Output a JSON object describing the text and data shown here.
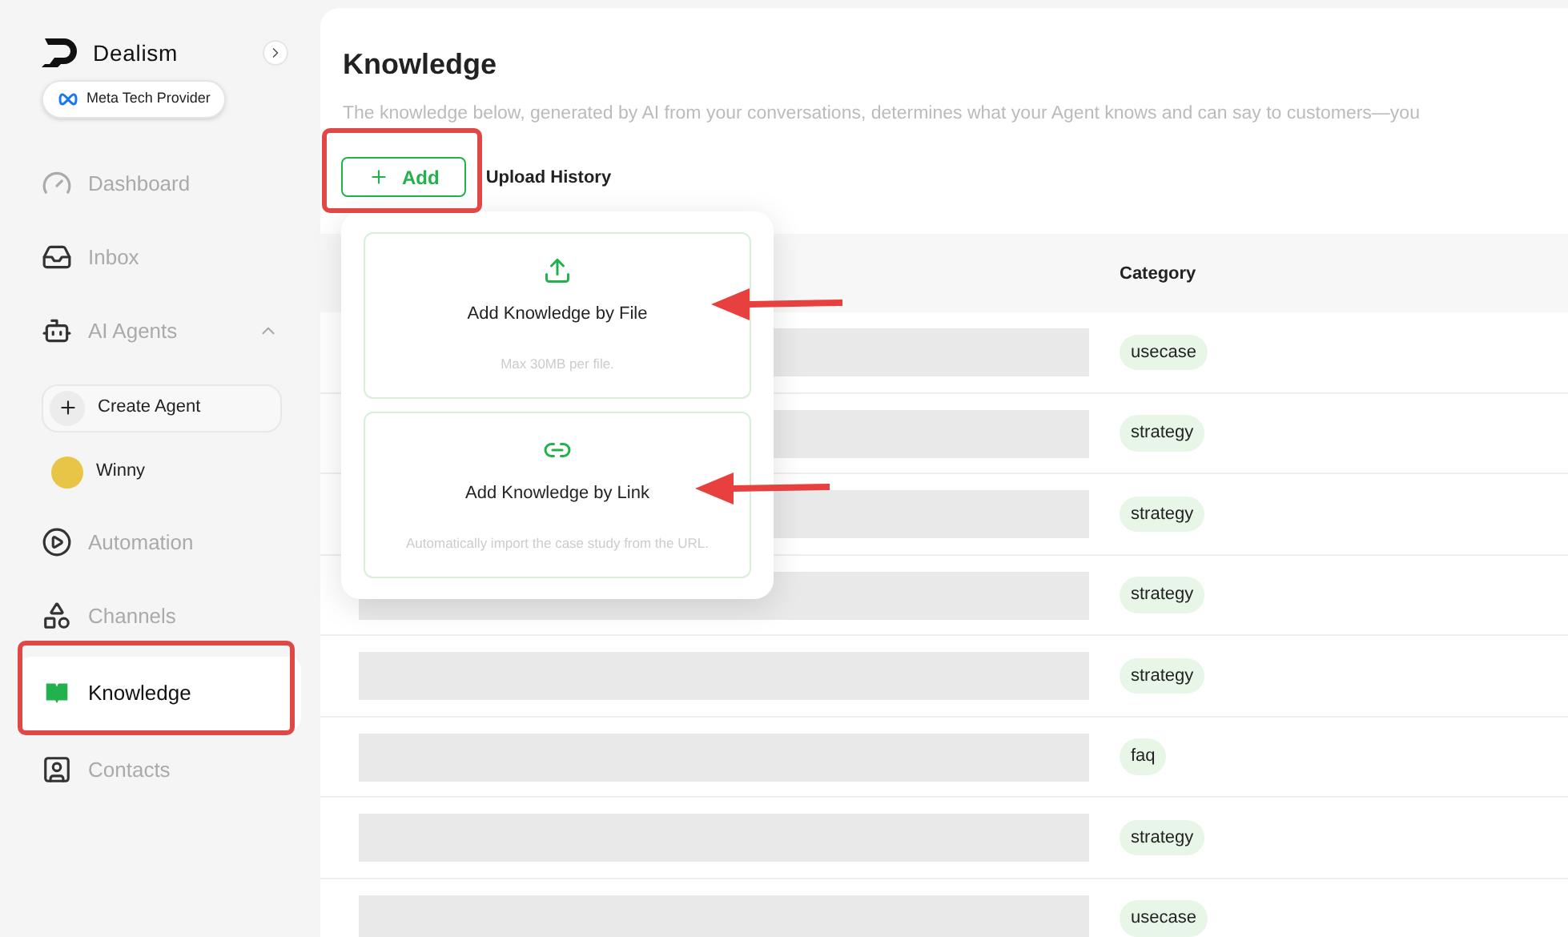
{
  "brand": {
    "name": "Dealism",
    "badge": "Meta Tech Provider"
  },
  "sidebar": {
    "items": [
      {
        "kind": "nav",
        "label": "Dashboard",
        "selected": false
      },
      {
        "kind": "nav",
        "label": "Inbox",
        "selected": false
      },
      {
        "kind": "group",
        "label": "AI Agents",
        "expanded": true,
        "children": [
          {
            "kind": "action",
            "label": "Create Agent"
          },
          {
            "kind": "agent",
            "label": "Winny"
          }
        ]
      },
      {
        "kind": "nav",
        "label": "Automation",
        "selected": false
      },
      {
        "kind": "nav",
        "label": "Channels",
        "selected": false
      },
      {
        "kind": "nav",
        "label": "Knowledge",
        "selected": true
      },
      {
        "kind": "nav",
        "label": "Contacts",
        "selected": false
      }
    ]
  },
  "page": {
    "title": "Knowledge",
    "description": "The knowledge below, generated by AI from your conversations, determines what your Agent knows and can say to customers—you",
    "toolbar": [
      {
        "kind": "add",
        "label": "Add"
      },
      {
        "kind": "link",
        "label": "Upload History"
      }
    ]
  },
  "add_menu": {
    "options": [
      {
        "kind": "file",
        "title": "Add Knowledge by File",
        "hint": "Max 30MB per file."
      },
      {
        "kind": "link",
        "title": "Add Knowledge by Link",
        "hint": "Automatically import the case study from the URL."
      }
    ]
  },
  "table": {
    "columns": [
      {
        "label": "Category"
      }
    ],
    "rows": [
      {
        "category": "usecase"
      },
      {
        "category": "strategy"
      },
      {
        "category": "strategy"
      },
      {
        "category": "strategy"
      },
      {
        "category": "strategy"
      },
      {
        "category": "faq"
      },
      {
        "category": "strategy"
      },
      {
        "category": "usecase"
      }
    ]
  }
}
